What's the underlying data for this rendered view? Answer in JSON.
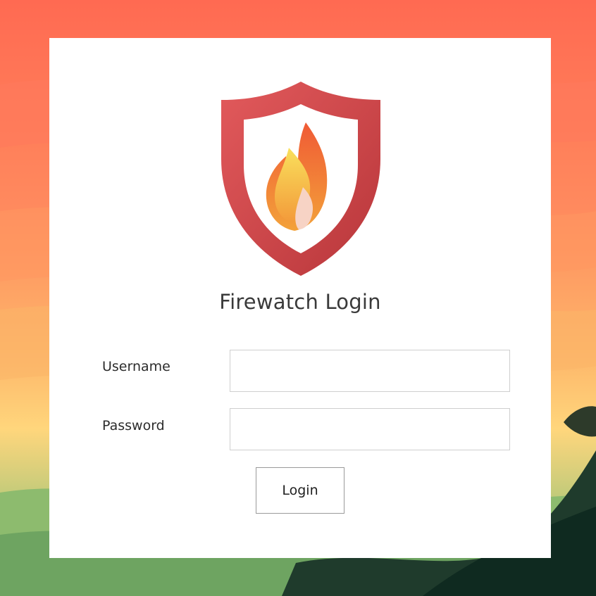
{
  "login": {
    "title": "Firewatch Login",
    "username_label": "Username",
    "password_label": "Password",
    "username_value": "",
    "password_value": "",
    "submit_label": "Login"
  },
  "logo": {
    "icon": "flame-shield-icon",
    "shield_color": "#d9464a",
    "flame_colors": [
      "#f0a33a",
      "#e9552f",
      "#f7d65b"
    ]
  },
  "theme": {
    "card_background": "#ffffff",
    "background_style": "stylized sunset landscape"
  }
}
